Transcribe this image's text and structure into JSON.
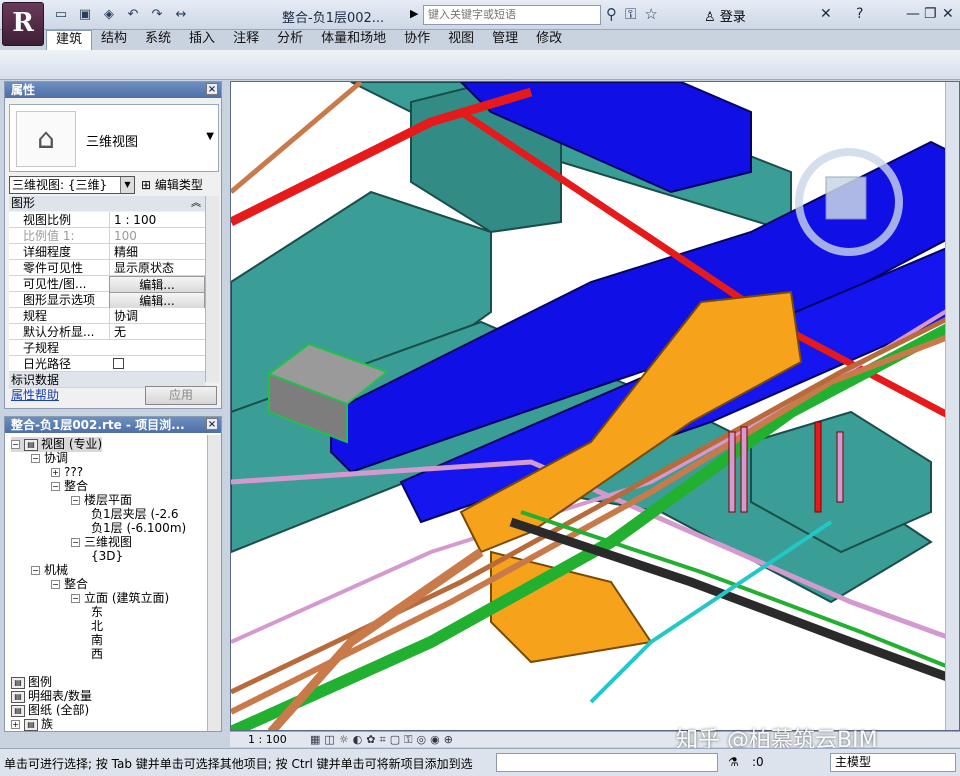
{
  "app": {
    "logo": "R",
    "document_title": "整合-负1层002...",
    "search_placeholder": "键入关键字或短语",
    "login_label": "登录"
  },
  "ribbon": {
    "tabs": [
      "建筑",
      "结构",
      "系统",
      "插入",
      "注释",
      "分析",
      "体量和场地",
      "协作",
      "视图",
      "管理",
      "修改"
    ],
    "active_tab": "建筑"
  },
  "properties": {
    "title": "属性",
    "type_name": "三维视图",
    "view_selector": "三维视图: {三维}",
    "edit_type_label": "编辑类型",
    "group_label": "图形",
    "rows": [
      {
        "key": "视图比例",
        "value": "1 : 100"
      },
      {
        "key": "比例值 1:",
        "value": "100"
      },
      {
        "key": "详细程度",
        "value": "精细"
      },
      {
        "key": "零件可见性",
        "value": "显示原状态"
      },
      {
        "key": "可见性/图...",
        "value": "编辑..."
      },
      {
        "key": "图形显示选项",
        "value": "编辑..."
      },
      {
        "key": "规程",
        "value": "协调"
      },
      {
        "key": "默认分析显...",
        "value": "无"
      },
      {
        "key": "子规程",
        "value": ""
      },
      {
        "key": "日光路径",
        "value": ""
      },
      {
        "key": "标识数据",
        "value": ""
      }
    ],
    "help_link": "属性帮助",
    "apply_label": "应用"
  },
  "browser": {
    "title": "整合-负1层002.rte - 项目浏...",
    "nodes": [
      {
        "label": "视图 (专业)",
        "level": 0,
        "toggle": "−"
      },
      {
        "label": "协调",
        "level": 1,
        "toggle": "−"
      },
      {
        "label": "???",
        "level": 2,
        "toggle": "+"
      },
      {
        "label": "整合",
        "level": 2,
        "toggle": "−"
      },
      {
        "label": "楼层平面",
        "level": 3,
        "toggle": "−"
      },
      {
        "label": "负1层夹层 (-2.6",
        "level": 4,
        "toggle": ""
      },
      {
        "label": "负1层 (-6.100m)",
        "level": 4,
        "toggle": ""
      },
      {
        "label": "三维视图",
        "level": 3,
        "toggle": "−"
      },
      {
        "label": "{3D}",
        "level": 4,
        "toggle": ""
      },
      {
        "label": "机械",
        "level": 1,
        "toggle": "−"
      },
      {
        "label": "整合",
        "level": 2,
        "toggle": "−"
      },
      {
        "label": "立面 (建筑立面)",
        "level": 3,
        "toggle": "−"
      },
      {
        "label": "东",
        "level": 4,
        "toggle": ""
      },
      {
        "label": "北",
        "level": 4,
        "toggle": ""
      },
      {
        "label": "南",
        "level": 4,
        "toggle": ""
      },
      {
        "label": "西",
        "level": 4,
        "toggle": ""
      },
      {
        "label": "",
        "level": 0,
        "toggle": ""
      },
      {
        "label": "图例",
        "level": 0,
        "toggle": ""
      },
      {
        "label": "明细表/数量",
        "level": 0,
        "toggle": ""
      },
      {
        "label": "图纸 (全部)",
        "level": 0,
        "toggle": ""
      },
      {
        "label": "族",
        "level": 0,
        "toggle": "+"
      }
    ]
  },
  "view_bar": {
    "scale": "1 : 100"
  },
  "status_bar": {
    "message": "单击可进行选择; 按 Tab 键并单击可选择其他项目; 按 Ctrl 键并单击可将新项目添加到选",
    "filter_count": ":0",
    "model": "主模型"
  },
  "watermark": "知乎 @柏慕筑云BIM",
  "colors": {
    "duct_blue": "#1010e6",
    "duct_teal": "#3a9e96",
    "pipe_red": "#e61a1a",
    "cable_tray_orange": "#f7a21b",
    "pipe_green": "#22b030",
    "pipe_pink": "#d49ad0"
  }
}
